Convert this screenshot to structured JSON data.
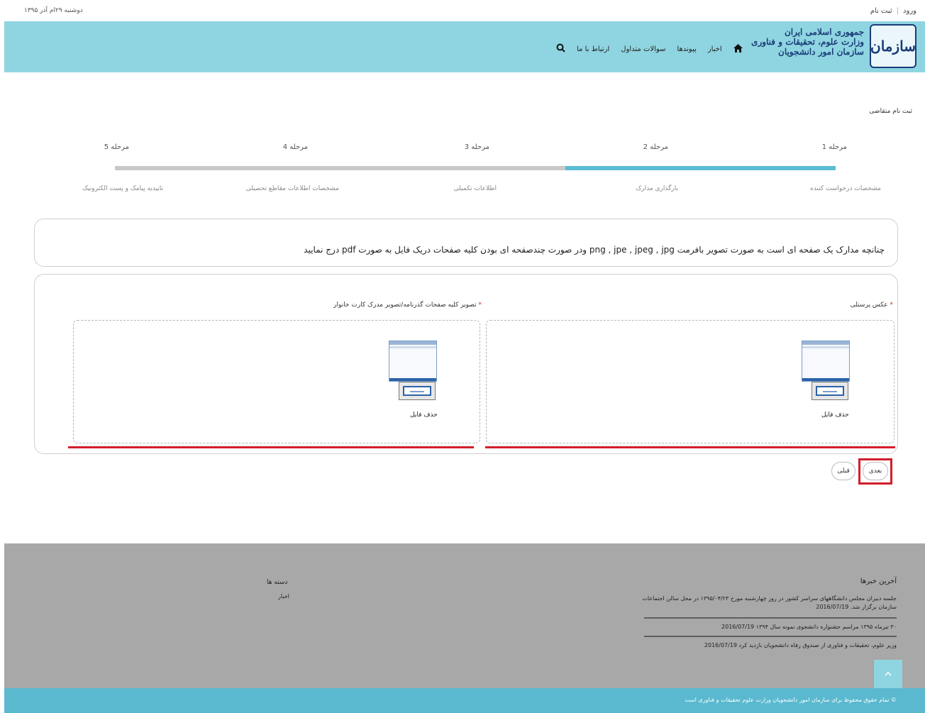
{
  "topbar": {
    "date": "دوشنبه ۲۹ام آذر ۱۳۹۵",
    "login": "ورود",
    "register": "ثبت نام",
    "separator": "|"
  },
  "header": {
    "logo_glyph": "سازمان",
    "brand_line1": "جمهوری اسلامی ایران",
    "brand_line2": "وزارت علوم، تحقیقات و فناوری",
    "brand_line3": "سازمان امور دانشجویان",
    "nav": {
      "home_icon": "home-icon",
      "news": "اخبار",
      "links": "پیوندها",
      "faq": "سوالات متداول",
      "contact": "ارتباط با ما",
      "search_icon": "search-icon"
    },
    "bg_color": "#8fd5e1"
  },
  "main": {
    "page_title": "ثبت نام متقاضی",
    "steps": [
      {
        "label": "مرحله 1",
        "desc": "مشخصات درخواست کننده"
      },
      {
        "label": "مرحله 2",
        "desc": "بارگذاری مدارک"
      },
      {
        "label": "مرحله 3",
        "desc": "اطلاعات تکمیلی"
      },
      {
        "label": "مرحله 4",
        "desc": "مشخصات اطلاعات مقاطع تحصیلی"
      },
      {
        "label": "مرحله 5",
        "desc": "تاییدیه پیامک و پست الکترونیک"
      }
    ],
    "progress_fraction": 0.375,
    "progress_color": "#5cbcd4",
    "notice": "چنانچه مدارک یک صفحه ای است به صورت تصویر بافرمت png , jpe , jpeg , jpg ودر صورت چندصفحه ای بودن کلیه صفحات دریک فایل به صورت pdf درج نمایید",
    "uploads": [
      {
        "label": "عکس پرسنلی",
        "required": "*",
        "delete": "حذف فایل"
      },
      {
        "label": "تصویر کلیه صفحات گذرنامه/تصویر مدرک کارت خانوار",
        "required": "*",
        "delete": "حذف فایل"
      }
    ],
    "buttons": {
      "next": "بعدی",
      "prev": "قبلی"
    },
    "highlight_color": "#d21e2a"
  },
  "footer": {
    "news_title": "آخرین خبرها",
    "news": [
      {
        "text": "جلسه دبیران مجلس دانشگاههای سراسر کشور در روز چهارشنبه مورخ ۱۳۹۵/۰۴/۲۳ در محل سالن اجتماعات سازمان برگزار شد.",
        "date": "2016/07/19"
      },
      {
        "text": "۳۰ تیرماه ۱۳۹۵ مراسم جشنواره دانشجوی نمونه سال ۱۳۹۴",
        "date": "2016/07/19"
      },
      {
        "text": "وزیر علوم، تحقیقات و فناوری از صندوق رفاه دانشجویان بازدید کرد",
        "date": "2016/07/19"
      }
    ],
    "categories_title": "دسته ها",
    "category_item": "اخبار",
    "scroll_top_icon": "chevron-up-icon",
    "copyright": "© تمام حقوق محفوظ برای سازمان امور دانشجویان وزارت علوم تحقیقات و فناوری است"
  }
}
